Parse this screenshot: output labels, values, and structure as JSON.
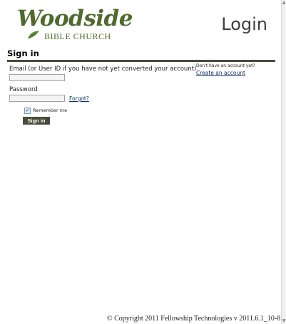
{
  "header": {
    "logo_script": "Woodside",
    "logo_sub": "BIBLE CHURCH",
    "page_heading": "Login"
  },
  "signin": {
    "section_title": "Sign in",
    "email_label": "Email (or User ID if you have not yet converted your account)",
    "email_value": "",
    "password_label": "Password",
    "password_value": "",
    "forgot_label": "Forgot?",
    "remember_label": "Remember me",
    "remember_checked": true,
    "button_label": "Sign in"
  },
  "account": {
    "prompt": "Don't have an account yet?",
    "create_label": "Create an account"
  },
  "footer": {
    "copyright": "© Copyright 2011 Fellowship Technologies  v 2011.6.1_10-8"
  },
  "colors": {
    "brand_green": "#4e6a2e",
    "divider": "#4a4a3a",
    "link": "#0b2f62"
  }
}
